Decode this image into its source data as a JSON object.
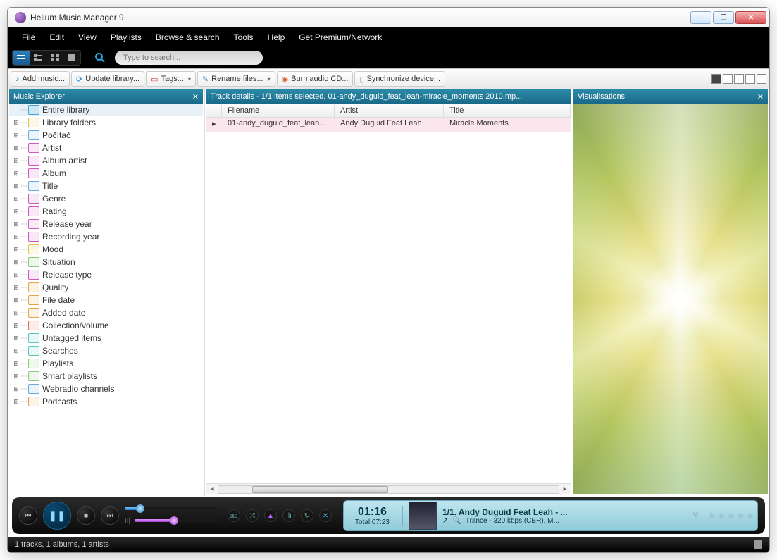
{
  "window": {
    "title": "Helium Music Manager 9"
  },
  "menubar": [
    "File",
    "Edit",
    "View",
    "Playlists",
    "Browse & search",
    "Tools",
    "Help",
    "Get Premium/Network"
  ],
  "search": {
    "placeholder": "Type to search..."
  },
  "actions": {
    "add_music": "Add music...",
    "update_library": "Update library...",
    "tags": "Tags...",
    "rename_files": "Rename files...",
    "burn_cd": "Burn audio CD...",
    "sync_device": "Synchronize device..."
  },
  "explorer": {
    "title": "Music Explorer",
    "items": [
      {
        "label": "Entire library",
        "color": "#3aa8d8",
        "selected": true,
        "expandable": false
      },
      {
        "label": "Library folders",
        "color": "#e6c24a",
        "selected": false,
        "expandable": true
      },
      {
        "label": "Počítač",
        "color": "#6aa8e0",
        "selected": false,
        "expandable": true
      },
      {
        "label": "Artist",
        "color": "#d058c0",
        "selected": false,
        "expandable": true
      },
      {
        "label": "Album artist",
        "color": "#d058c0",
        "selected": false,
        "expandable": true
      },
      {
        "label": "Album",
        "color": "#d058c0",
        "selected": false,
        "expandable": true
      },
      {
        "label": "Title",
        "color": "#6aa8e0",
        "selected": false,
        "expandable": true
      },
      {
        "label": "Genre",
        "color": "#d058c0",
        "selected": false,
        "expandable": true
      },
      {
        "label": "Rating",
        "color": "#d058c0",
        "selected": false,
        "expandable": true
      },
      {
        "label": "Release year",
        "color": "#d058c0",
        "selected": false,
        "expandable": true
      },
      {
        "label": "Recording year",
        "color": "#d058c0",
        "selected": false,
        "expandable": true
      },
      {
        "label": "Mood",
        "color": "#e6c24a",
        "selected": false,
        "expandable": true
      },
      {
        "label": "Situation",
        "color": "#8ac87a",
        "selected": false,
        "expandable": true
      },
      {
        "label": "Release type",
        "color": "#d058c0",
        "selected": false,
        "expandable": true
      },
      {
        "label": "Quality",
        "color": "#e6a24a",
        "selected": false,
        "expandable": true
      },
      {
        "label": "File date",
        "color": "#e6a24a",
        "selected": false,
        "expandable": true
      },
      {
        "label": "Added date",
        "color": "#e6a24a",
        "selected": false,
        "expandable": true
      },
      {
        "label": "Collection/volume",
        "color": "#e66a5a",
        "selected": false,
        "expandable": true
      },
      {
        "label": "Untagged items",
        "color": "#5ac8b8",
        "selected": false,
        "expandable": true
      },
      {
        "label": "Searches",
        "color": "#5ac8b8",
        "selected": false,
        "expandable": true
      },
      {
        "label": "Playlists",
        "color": "#8ac87a",
        "selected": false,
        "expandable": true
      },
      {
        "label": "Smart playlists",
        "color": "#8ac87a",
        "selected": false,
        "expandable": true
      },
      {
        "label": "Webradio channels",
        "color": "#6aa8e0",
        "selected": false,
        "expandable": true
      },
      {
        "label": "Podcasts",
        "color": "#e6a24a",
        "selected": false,
        "expandable": true
      }
    ]
  },
  "details": {
    "title": "Track details - 1/1 items selected, 01-andy_duguid_feat_leah-miracle_moments 2010.mp...",
    "columns": {
      "filename": "Filename",
      "artist": "Artist",
      "title": "Title"
    },
    "rows": [
      {
        "filename": "01-andy_duguid_feat_leah...",
        "artist": "Andy Duguid Feat Leah",
        "title": "Miracle Moments"
      }
    ]
  },
  "visualisations": {
    "title": "Visualisations"
  },
  "player": {
    "elapsed": "01:16",
    "total_label": "Total 07:23",
    "progress_pct": 17,
    "volume_pct": 48,
    "track_line": "1/1. Andy Duguid Feat Leah - ...",
    "meta_line": "Trance - 320 kbps (CBR), M..."
  },
  "status": {
    "text": "1 tracks, 1 albums, 1 artists"
  },
  "icons": {
    "prev": "⏮",
    "play_pause": "❚❚",
    "stop": "■",
    "next": "⏭",
    "min": "—",
    "max": "❐",
    "close": "✕",
    "share": "↗",
    "search_small": "🔍"
  }
}
